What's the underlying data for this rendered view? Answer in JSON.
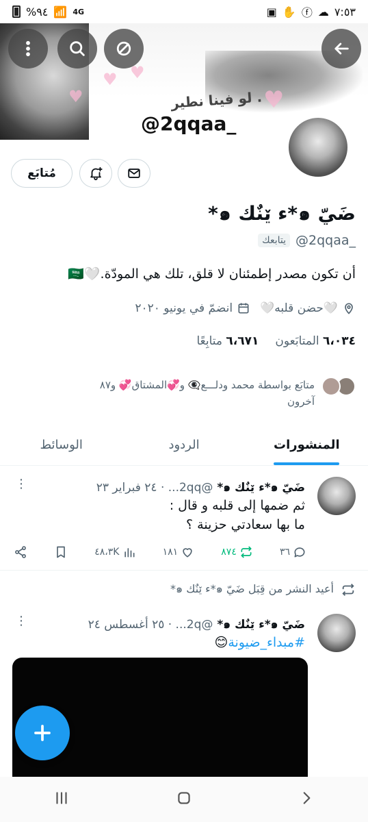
{
  "status_bar": {
    "time": "٧:٥٣",
    "battery": "%٩٤",
    "network": "4G"
  },
  "banner": {
    "caption": "لو فينا نطير .",
    "handle_overlay": "@2qqaa_"
  },
  "header": {
    "back_icon": "arrow-left-icon",
    "more_icon": "more-vertical-icon",
    "search_icon": "search-icon",
    "grok_icon": "slash-circle-icon"
  },
  "actions": {
    "follow_label": "مُتابَع",
    "notify_icon": "bell-plus-icon",
    "message_icon": "envelope-icon"
  },
  "profile": {
    "display_name": "ضَيّ ๑*ء ێنٌك ๑*",
    "handle": "@2qqaa_",
    "follows_you": "يتابعك",
    "bio": "أن تكون مصدر إطمئنان لا قلق، تلك هي المودّة.🤍🇸🇦",
    "location": "🤍حضن قلبه🤍",
    "joined": "انضمّ في يونيو ٢٠٢٠",
    "followers_count": "٦،٠٣٤",
    "followers_label": "المتابَعون",
    "following_count": "٦،٦٧١",
    "following_label": "متابِعًا",
    "known_followers": "متابَع بواسطة محمد ودلـــع👁‍🗨 و💞المشتاق💞 و٨٧",
    "known_followers_more": "آخرون"
  },
  "tabs": [
    {
      "label": "المنشورات",
      "active": true
    },
    {
      "label": "الردود",
      "active": false
    },
    {
      "label": "الوسائط",
      "active": false
    }
  ],
  "posts": [
    {
      "name": "ضَيّ ๑*ء ێنٌك ๑*",
      "meta": "@2qq... · ٢٤ فبراير ٢٣",
      "text_line1": "ثم ضمها إلى قلبه و قال :",
      "text_line2": "ما بها سعادتي حزينة ؟",
      "replies": "٣٦",
      "reposts": "٨٧٤",
      "likes": "١٨١",
      "views": "٤٨،٣K"
    },
    {
      "repost_label": "أعيد النشر من قِبَل ضَيّ ๑*ء ێنٌك ๑*",
      "name": "ضَيّ ๑*ء ێنٌك ๑*",
      "meta": "@2q... · ٢٥ أغسطس ٢٤",
      "hashtag": "#مبداء_ضيونة",
      "emoji": "😊"
    }
  ]
}
